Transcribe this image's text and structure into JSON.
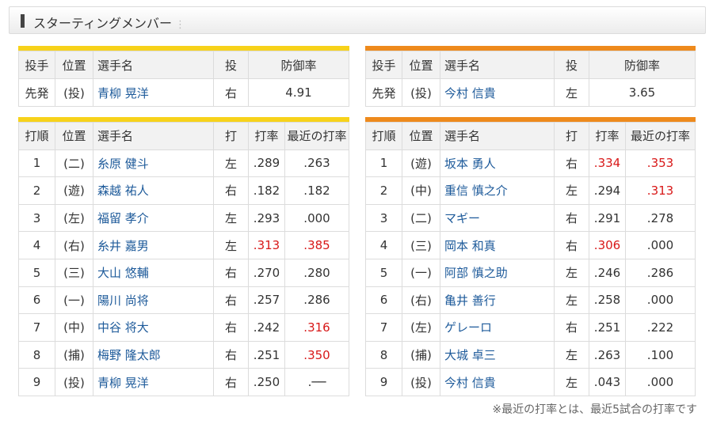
{
  "header": {
    "title": "スターティングメンバー"
  },
  "pitcher_headers": [
    "投手",
    "位置",
    "選手名",
    "投",
    "防御率"
  ],
  "batting_headers": [
    "打順",
    "位置",
    "選手名",
    "打",
    "打率",
    "最近の打率"
  ],
  "home": {
    "accent_color": "#f7d21a",
    "pitcher": {
      "role": "先発",
      "pos": "(投)",
      "name": "青柳 晃洋",
      "hand": "右",
      "era": "4.91"
    },
    "lineup": [
      {
        "order": "1",
        "pos": "(二)",
        "name": "糸原 健斗",
        "hand": "左",
        "avg": ".289",
        "recent": ".263",
        "avg_red": false,
        "recent_red": false
      },
      {
        "order": "2",
        "pos": "(遊)",
        "name": "森越 祐人",
        "hand": "右",
        "avg": ".182",
        "recent": ".182",
        "avg_red": false,
        "recent_red": false
      },
      {
        "order": "3",
        "pos": "(左)",
        "name": "福留 孝介",
        "hand": "左",
        "avg": ".293",
        "recent": ".000",
        "avg_red": false,
        "recent_red": false
      },
      {
        "order": "4",
        "pos": "(右)",
        "name": "糸井 嘉男",
        "hand": "左",
        "avg": ".313",
        "recent": ".385",
        "avg_red": true,
        "recent_red": true
      },
      {
        "order": "5",
        "pos": "(三)",
        "name": "大山 悠輔",
        "hand": "右",
        "avg": ".270",
        "recent": ".280",
        "avg_red": false,
        "recent_red": false
      },
      {
        "order": "6",
        "pos": "(一)",
        "name": "陽川 尚将",
        "hand": "右",
        "avg": ".257",
        "recent": ".286",
        "avg_red": false,
        "recent_red": false
      },
      {
        "order": "7",
        "pos": "(中)",
        "name": "中谷 将大",
        "hand": "右",
        "avg": ".242",
        "recent": ".316",
        "avg_red": false,
        "recent_red": true
      },
      {
        "order": "8",
        "pos": "(捕)",
        "name": "梅野 隆太郎",
        "hand": "右",
        "avg": ".251",
        "recent": ".350",
        "avg_red": false,
        "recent_red": true
      },
      {
        "order": "9",
        "pos": "(投)",
        "name": "青柳 晃洋",
        "hand": "右",
        "avg": ".250",
        "recent": ".──",
        "avg_red": false,
        "recent_red": false
      }
    ]
  },
  "away": {
    "accent_color": "#ee8a1c",
    "pitcher": {
      "role": "先発",
      "pos": "(投)",
      "name": "今村 信貴",
      "hand": "左",
      "era": "3.65"
    },
    "lineup": [
      {
        "order": "1",
        "pos": "(遊)",
        "name": "坂本 勇人",
        "hand": "右",
        "avg": ".334",
        "recent": ".353",
        "avg_red": true,
        "recent_red": true
      },
      {
        "order": "2",
        "pos": "(中)",
        "name": "重信 慎之介",
        "hand": "左",
        "avg": ".294",
        "recent": ".313",
        "avg_red": false,
        "recent_red": true
      },
      {
        "order": "3",
        "pos": "(二)",
        "name": "マギー",
        "hand": "右",
        "avg": ".291",
        "recent": ".278",
        "avg_red": false,
        "recent_red": false
      },
      {
        "order": "4",
        "pos": "(三)",
        "name": "岡本 和真",
        "hand": "右",
        "avg": ".306",
        "recent": ".000",
        "avg_red": true,
        "recent_red": false
      },
      {
        "order": "5",
        "pos": "(一)",
        "name": "阿部 慎之助",
        "hand": "左",
        "avg": ".246",
        "recent": ".286",
        "avg_red": false,
        "recent_red": false
      },
      {
        "order": "6",
        "pos": "(右)",
        "name": "亀井 善行",
        "hand": "左",
        "avg": ".258",
        "recent": ".000",
        "avg_red": false,
        "recent_red": false
      },
      {
        "order": "7",
        "pos": "(左)",
        "name": "ゲレーロ",
        "hand": "右",
        "avg": ".251",
        "recent": ".222",
        "avg_red": false,
        "recent_red": false
      },
      {
        "order": "8",
        "pos": "(捕)",
        "name": "大城 卓三",
        "hand": "左",
        "avg": ".263",
        "recent": ".100",
        "avg_red": false,
        "recent_red": false
      },
      {
        "order": "9",
        "pos": "(投)",
        "name": "今村 信貴",
        "hand": "左",
        "avg": ".043",
        "recent": ".000",
        "avg_red": false,
        "recent_red": false
      }
    ]
  },
  "footnote": "※最近の打率とは、最近5試合の打率です"
}
